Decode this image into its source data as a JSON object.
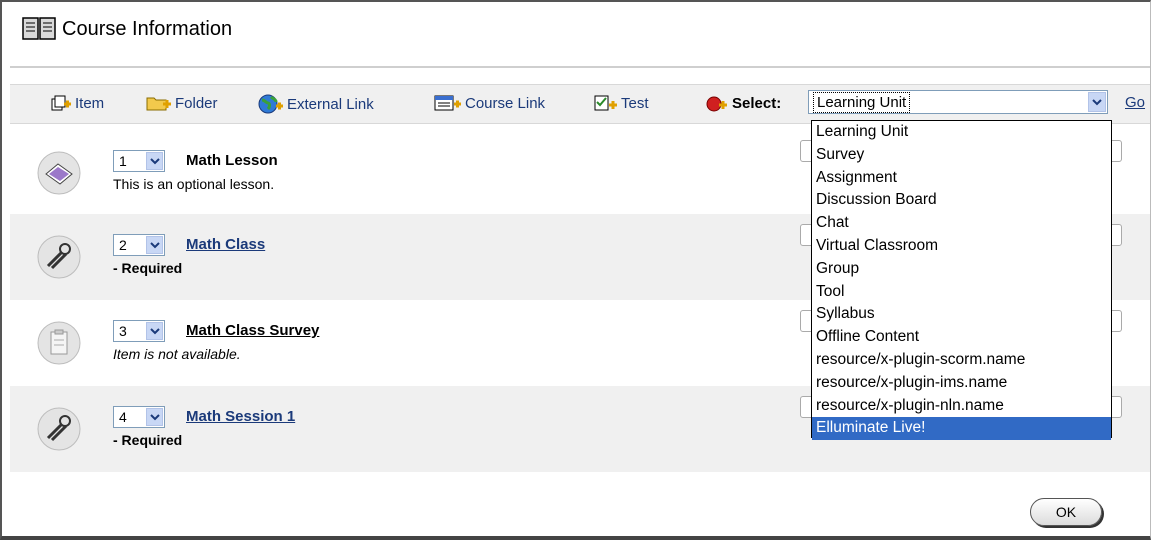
{
  "page": {
    "title": "Course Information"
  },
  "toolbar": {
    "item_label": "Item",
    "folder_label": "Folder",
    "external_link_label": "External Link",
    "course_link_label": "Course Link",
    "test_label": "Test",
    "select_label": "Select:",
    "select_value": "Learning Unit",
    "go_label": "Go"
  },
  "dropdown": {
    "options": [
      "Learning Unit",
      "Survey",
      "Assignment",
      "Discussion Board",
      "Chat",
      "Virtual Classroom",
      "Group",
      "Tool",
      "Syllabus",
      "Offline Content",
      "resource/x-plugin-scorm.name",
      "resource/x-plugin-ims.name",
      "resource/x-plugin-nln.name",
      "Elluminate Live!"
    ],
    "highlighted": "Elluminate Live!"
  },
  "items": [
    {
      "order": "1",
      "title": "Math Lesson",
      "desc": "This is an optional lesson.",
      "icon": "lesson-icon"
    },
    {
      "order": "2",
      "title": "Math Class",
      "desc": "- Required",
      "icon": "tools-icon"
    },
    {
      "order": "3",
      "title": "Math Class Survey",
      "desc": "Item is not available.",
      "icon": "survey-icon"
    },
    {
      "order": "4",
      "title": "Math Session 1",
      "desc": "- Required",
      "icon": "tools-icon"
    }
  ],
  "footer": {
    "ok_label": "OK"
  },
  "colors": {
    "link": "#1b3a7a",
    "highlight": "#316ac5",
    "row_shade": "#f0f0f0"
  }
}
